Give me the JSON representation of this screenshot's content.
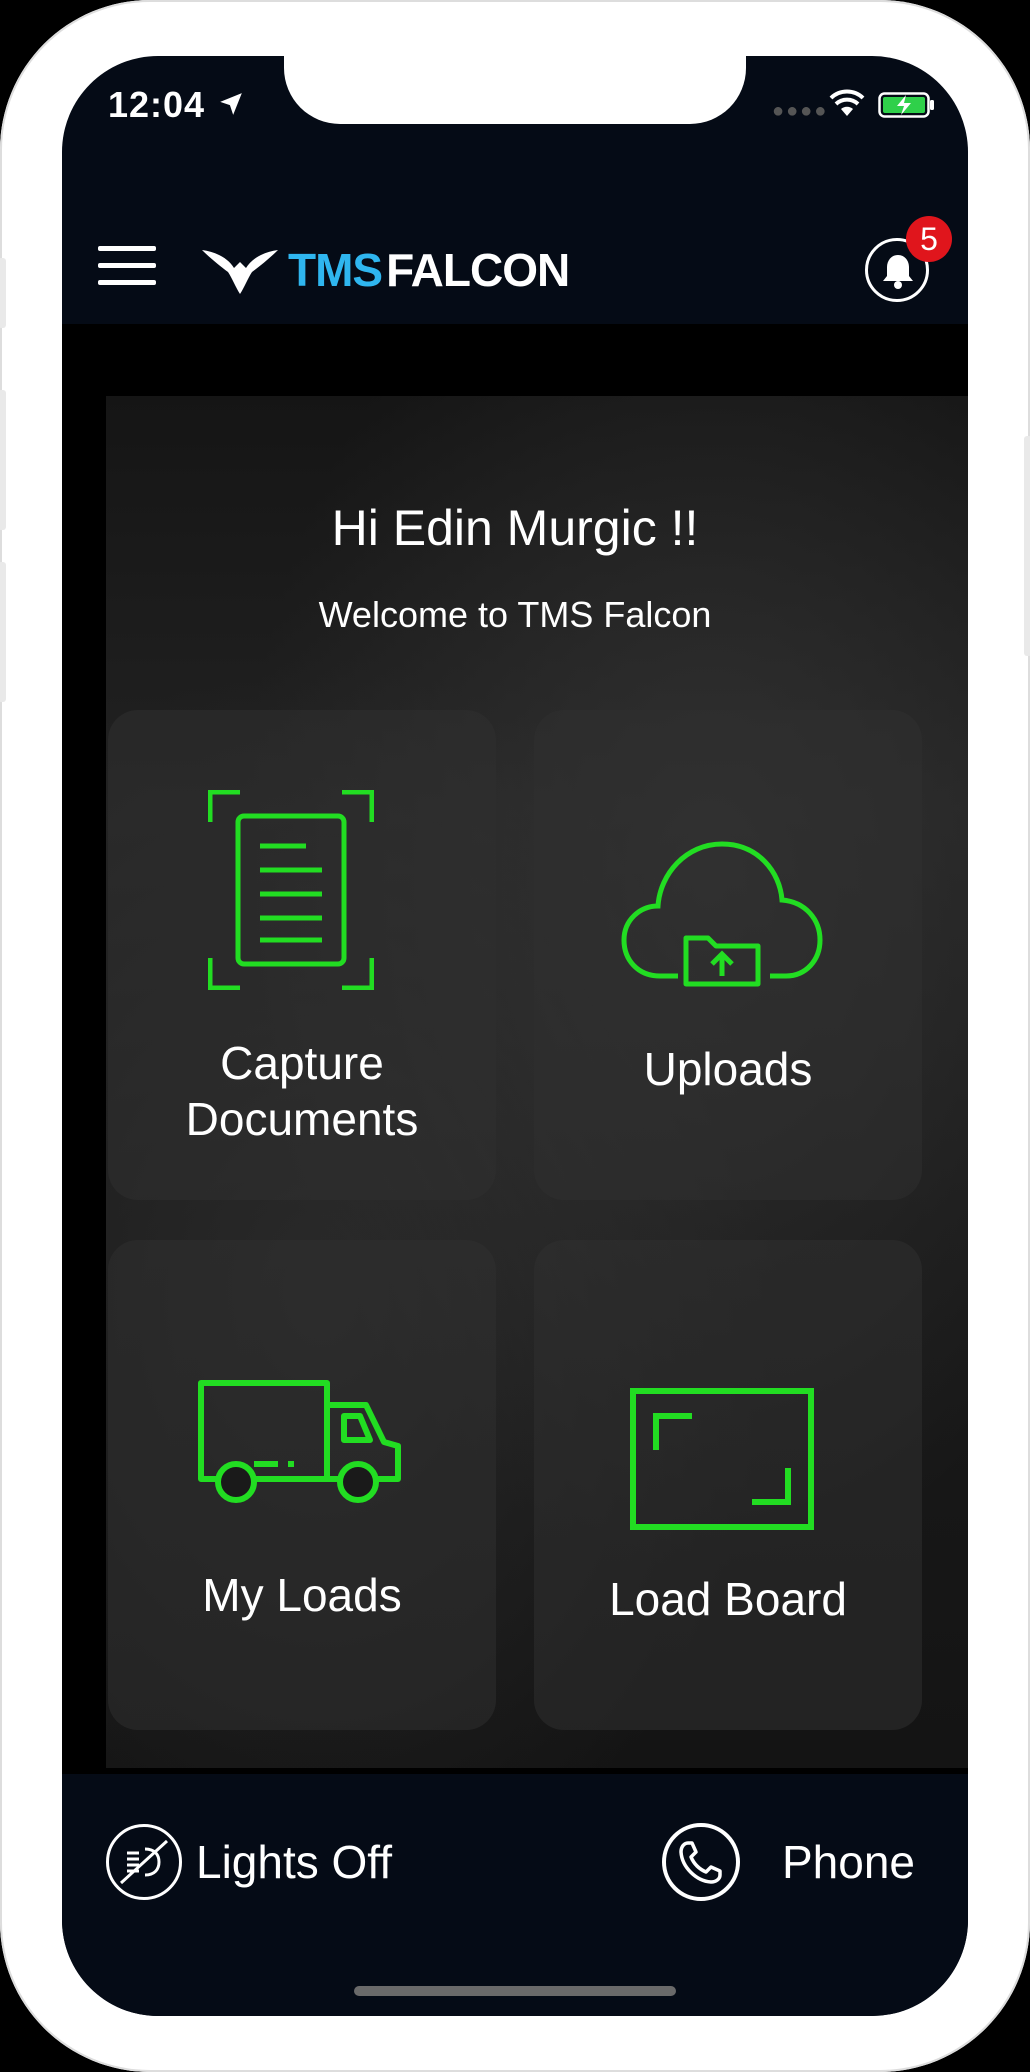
{
  "status_bar": {
    "time": "12:04"
  },
  "header": {
    "logo_part1": "TMS",
    "logo_part2": "FALCON",
    "notification_count": "5"
  },
  "main": {
    "greeting": "Hi Edin Murgic !!",
    "welcome": "Welcome to TMS Falcon",
    "tiles": [
      {
        "line1": "Capture",
        "line2": "Documents"
      },
      {
        "label": "Uploads"
      },
      {
        "label": "My Loads"
      },
      {
        "label": "Load Board"
      }
    ]
  },
  "bottom_bar": {
    "lights_label": "Lights Off",
    "phone_label": "Phone"
  },
  "colors": {
    "accent_green": "#22dd22",
    "logo_blue": "#2fb6ef",
    "badge_red": "#e0151c",
    "bar_bg": "#050b16"
  }
}
